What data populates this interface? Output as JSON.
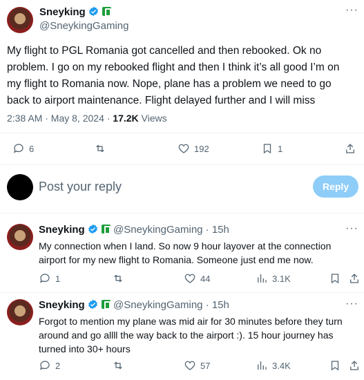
{
  "main_tweet": {
    "author_name": "Sneyking",
    "author_handle": "@SneykingGaming",
    "text": "My flight to PGL Romania got cancelled and then rebooked. Ok no problem. I go on my rebooked flight and then I think it’s all good I’m on my flight to Romania now. Nope, plane has a problem we need to go back to airport maintenance. Flight delayed further and I will miss",
    "time": "2:38 AM · May 8, 2024 · ",
    "views_count": "17.2K",
    "views_label": " Views",
    "replies": "6",
    "likes": "192",
    "bookmarks": "1"
  },
  "reply_box": {
    "placeholder": "Post your reply",
    "button_label": "Reply"
  },
  "replies": [
    {
      "author_name": "Sneyking",
      "author_handle": "@SneykingGaming · 15h",
      "text": "My connection when I land. So now 9 hour layover at the connection airport for my new flight to Romania. Someone just end me now.",
      "replies": "1",
      "likes": "44",
      "views": "3.1K"
    },
    {
      "author_name": "Sneyking",
      "author_handle": "@SneykingGaming · 15h",
      "text": "Forgot to mention my plane was mid air for 30 minutes before they turn around and go allll the way back to the airport :). 15 hour journey has turned into 30+ hours",
      "replies": "2",
      "likes": "57",
      "views": "3.4K"
    }
  ],
  "more_icon_text": "···",
  "colors": {
    "verified": "#1d9bf0",
    "badge": "#1d9e3b",
    "reply_button": "#8ecdf8",
    "secondary_text": "#536471"
  }
}
